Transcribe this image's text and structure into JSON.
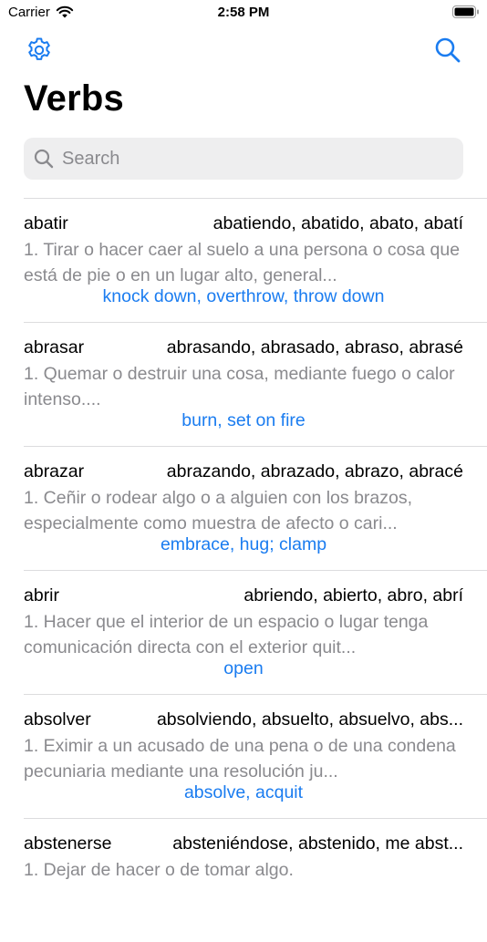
{
  "status": {
    "carrier": "Carrier",
    "time": "2:58 PM"
  },
  "nav": {
    "settings_icon": "gear-icon",
    "search_icon": "magnifying-glass-icon"
  },
  "page": {
    "title": "Verbs"
  },
  "search": {
    "placeholder": "Search"
  },
  "colors": {
    "accent": "#1a7cf0",
    "secondary_text": "#8a8a8e",
    "search_bg": "#eeeeef",
    "separator": "#dcdcde"
  },
  "verbs": [
    {
      "verb": "abatir",
      "forms": "abatiendo, abatido, abato, abatí",
      "definition": "1. Tirar o hacer caer al suelo a una persona o cosa que está de pie o en un lugar alto, general...",
      "translation": "knock down, overthrow, throw down"
    },
    {
      "verb": "abrasar",
      "forms": "abrasando, abrasado, abraso, abrasé",
      "definition": "1. Quemar o destruir una cosa, mediante fuego o calor intenso....",
      "translation": "burn, set on fire"
    },
    {
      "verb": "abrazar",
      "forms": "abrazando, abrazado, abrazo, abracé",
      "definition": "1. Ceñir o rodear algo o a alguien con los brazos, especialmente como muestra de afecto o cari...",
      "translation": "embrace, hug; clamp"
    },
    {
      "verb": "abrir",
      "forms": "abriendo, abierto, abro, abrí",
      "definition": "1. Hacer que el interior de un espacio o lugar tenga comunicación directa con el exterior quit...",
      "translation": "open"
    },
    {
      "verb": "absolver",
      "forms": "absolviendo, absuelto, absuelvo, abs...",
      "definition": "1. Eximir a un acusado de una pena o de una condena pecuniaria mediante una resolución ju...",
      "translation": "absolve, acquit"
    },
    {
      "verb": "abstenerse",
      "forms": "absteniéndose, abstenido, me abst...",
      "definition": "1. Dejar de hacer o de tomar algo.",
      "translation": ""
    }
  ]
}
